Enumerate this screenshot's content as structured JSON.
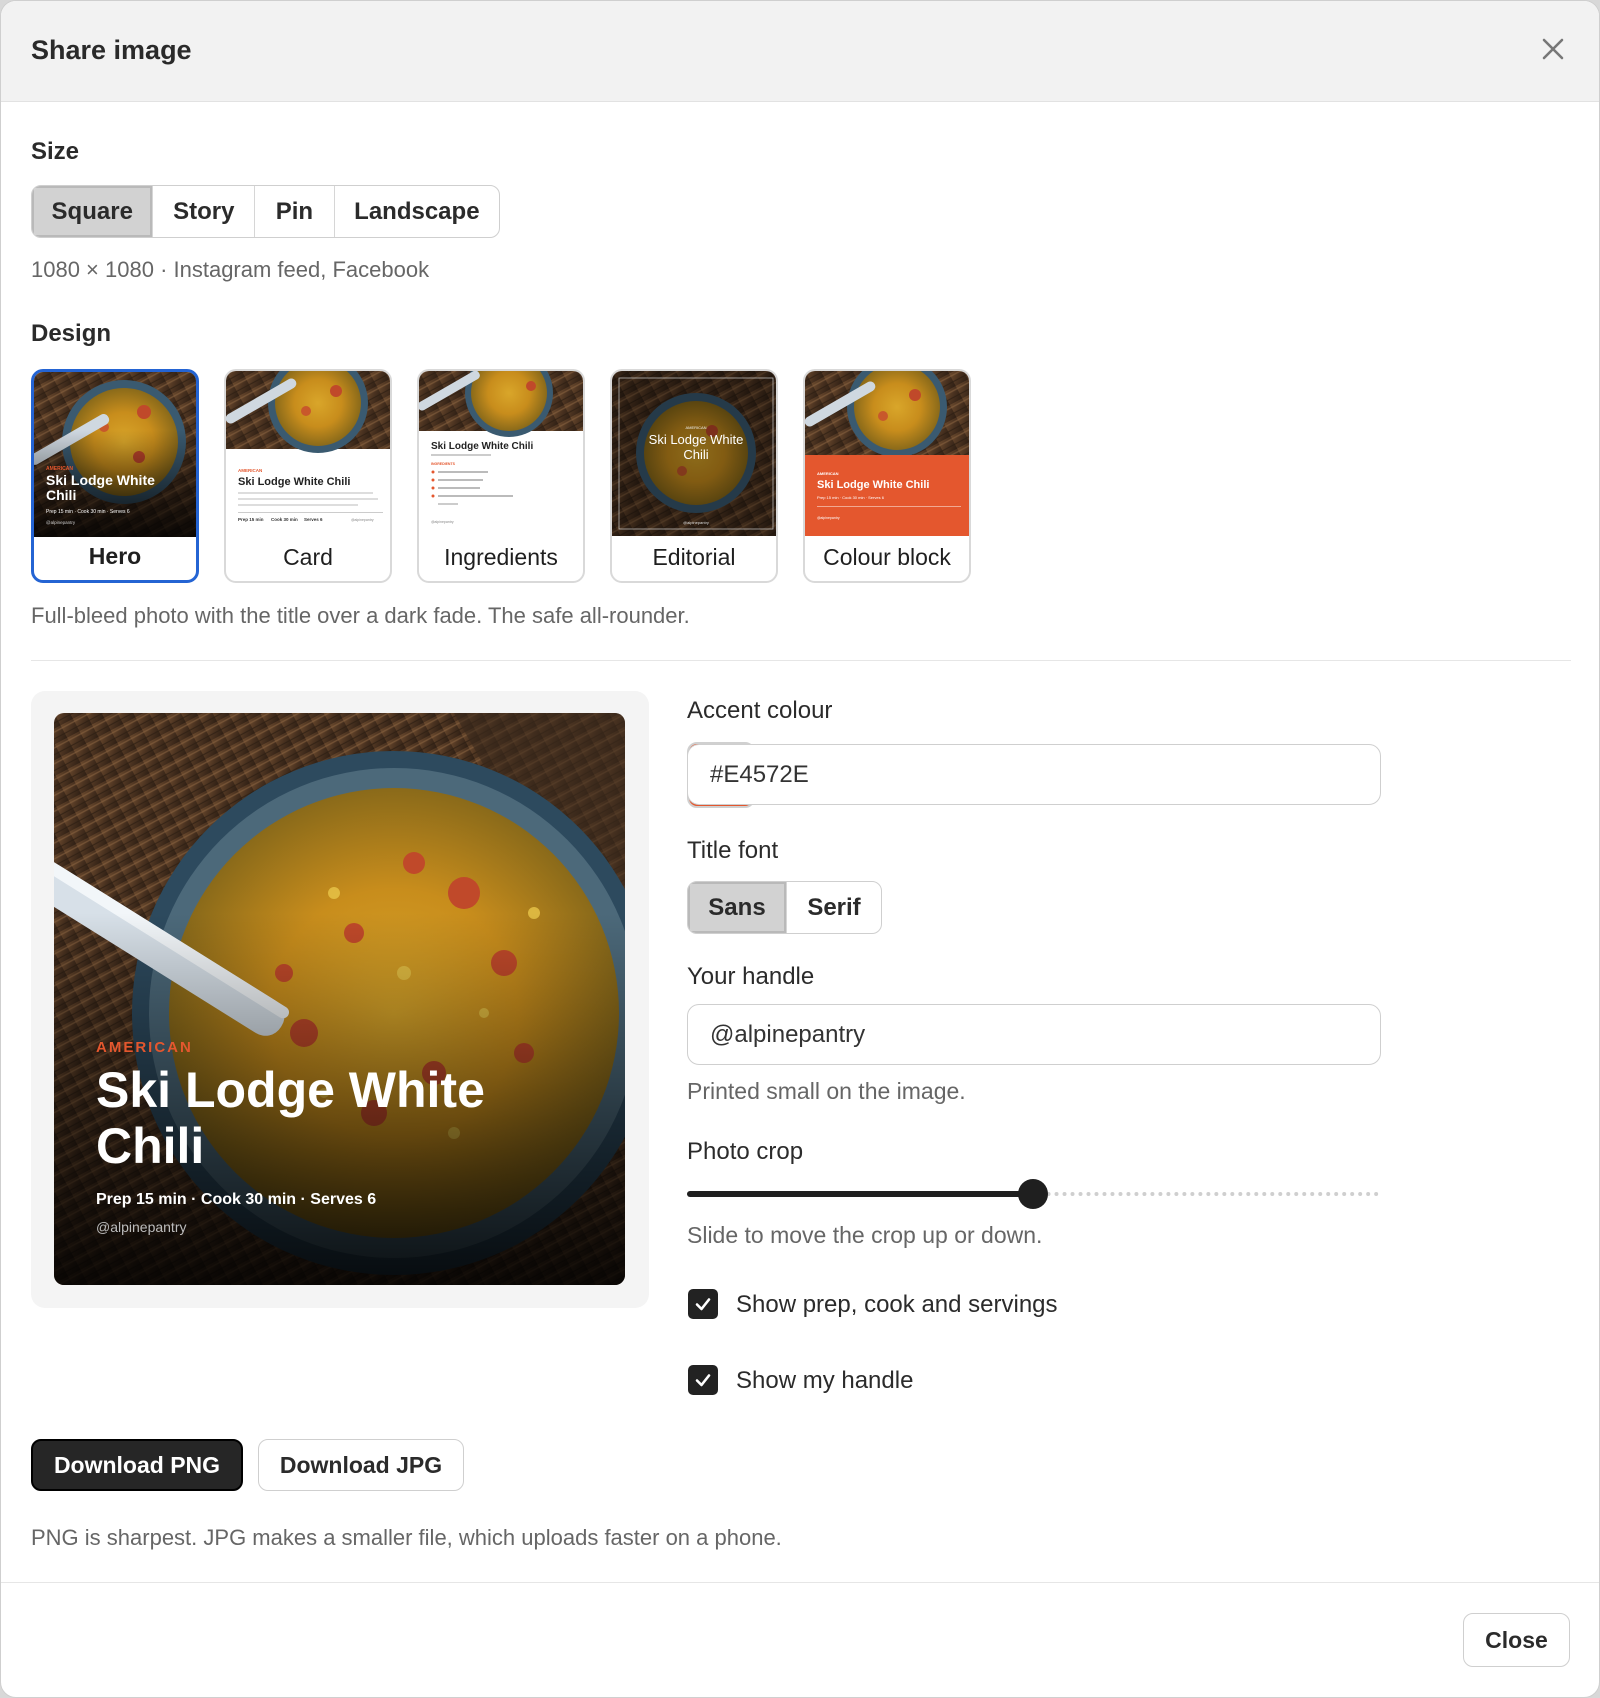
{
  "dialog": {
    "title": "Share image"
  },
  "size": {
    "label": "Size",
    "options": [
      "Square",
      "Story",
      "Pin",
      "Landscape"
    ],
    "selected": "Square",
    "hint": "1080 × 1080 · Instagram feed, Facebook"
  },
  "design": {
    "label": "Design",
    "options": [
      "Hero",
      "Card",
      "Ingredients",
      "Editorial",
      "Colour block"
    ],
    "selected": "Hero",
    "hint": "Full-bleed photo with the title over a dark fade. The safe all-rounder."
  },
  "thumbs": {
    "cuisine": "AMERICAN",
    "title": "Ski Lodge White Chili",
    "meta": "Prep 15 min · Cook 30 min · Serves 6",
    "card_meta": [
      "Prep 15 min",
      "Cook 30 min",
      "Serves 6"
    ],
    "ingredients_heading": "INGREDIENTS",
    "handle": "@alpinepantry"
  },
  "preview": {
    "cuisine": "AMERICAN",
    "title_line1": "Ski Lodge White",
    "title_line2": "Chili",
    "meta": "Prep 15 min · Cook 30 min · Serves 6",
    "handle": "@alpinepantry"
  },
  "accent": {
    "label": "Accent colour",
    "value": "#E4572E",
    "color": "#E4572E"
  },
  "title_font": {
    "label": "Title font",
    "options": [
      "Sans",
      "Serif"
    ],
    "selected": "Sans"
  },
  "handle_field": {
    "label": "Your handle",
    "value": "@alpinepantry",
    "help": "Printed small on the image."
  },
  "photo_crop": {
    "label": "Photo crop",
    "value_fraction": 0.5,
    "help": "Slide to move the crop up or down."
  },
  "options": {
    "show_meta": {
      "label": "Show prep, cook and servings",
      "checked": true
    },
    "show_handle": {
      "label": "Show my handle",
      "checked": true
    }
  },
  "downloads": {
    "png_label": "Download PNG",
    "jpg_label": "Download JPG",
    "hint": "PNG is sharpest. JPG makes a smaller file, which uploads faster on a phone."
  },
  "footer": {
    "close_label": "Close"
  }
}
